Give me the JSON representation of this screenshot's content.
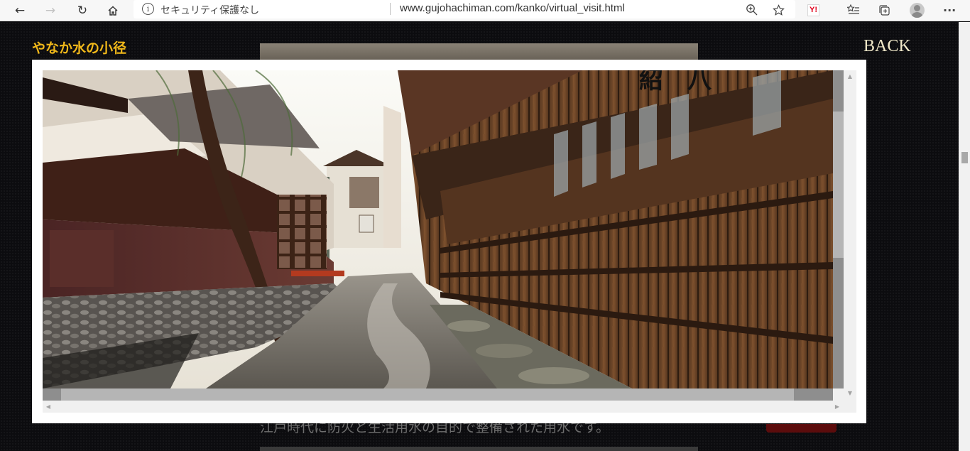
{
  "browser": {
    "security_label": "セキュリティ保護なし",
    "url": "www.gujohachiman.com/kanko/virtual_visit.html",
    "yahoo_badge": "Y!",
    "menu": "···"
  },
  "page": {
    "title": "やなか水の小径",
    "back_label": "BACK",
    "description": "江戸時代に防火と生活用水の目的で整備された用水です。"
  },
  "colors": {
    "title": "#f0b81a",
    "back": "#f0e8c8",
    "background": "#0c0c0f"
  },
  "viewer": {
    "image": "yanaka-mizu-no-komichi-panorama"
  }
}
